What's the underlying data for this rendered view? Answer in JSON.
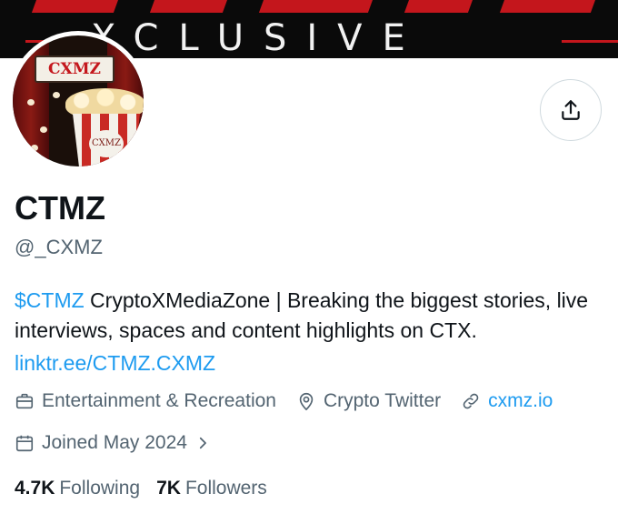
{
  "banner": {
    "text": "XCLUSIVE"
  },
  "avatar": {
    "sign_text": "CXMZ",
    "bucket_text": "CXMZ"
  },
  "profile": {
    "display_name": "CTMZ",
    "handle": "@_CXMZ",
    "bio_cashtag": "$CTMZ",
    "bio_text": " CryptoXMediaZone | Breaking the biggest stories, live interviews, spaces and content highlights on CTX.",
    "bio_link": "linktr.ee/CTMZ.CXMZ"
  },
  "meta": {
    "category": "Entertainment & Recreation",
    "location": "Crypto Twitter",
    "website": "cxmz.io",
    "joined": "Joined May 2024"
  },
  "stats": {
    "following_count": "4.7K",
    "following_label": "Following",
    "followers_count": "7K",
    "followers_label": "Followers"
  },
  "icons": {
    "share": "share-icon",
    "category": "briefcase-icon",
    "location": "location-pin-icon",
    "website": "link-icon",
    "joined": "calendar-icon",
    "expand": "chevron-right-icon"
  },
  "colors": {
    "accent": "#1d9bf0",
    "text_primary": "#0f1419",
    "text_secondary": "#536471",
    "banner_red": "#c4161c"
  }
}
